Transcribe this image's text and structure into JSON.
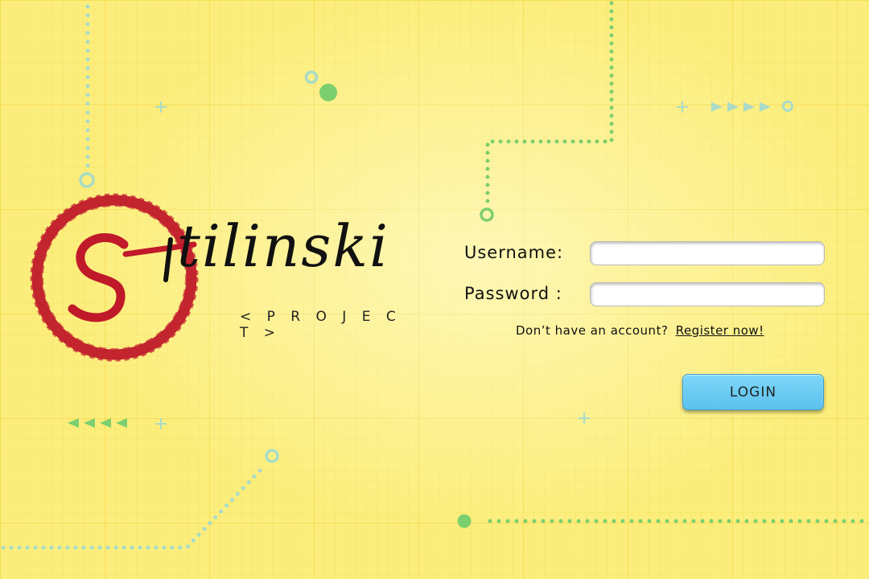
{
  "logo": {
    "word_first": "S",
    "word_rest": "tilinski",
    "subtitle": "< P R O J E C T >"
  },
  "login_form": {
    "username_label": "Username:",
    "password_label": "Password :",
    "username_value": "",
    "password_value": "",
    "register_prompt": "Don’t have an account?",
    "register_link": "Register now!",
    "login_button": "LOGIN"
  },
  "colors": {
    "background": "#fcee7c",
    "logo_red": "#c0192a",
    "button_blue": "#6fcdf5",
    "dot_green": "#7ccf6e",
    "dot_teal": "#a9dbc8"
  }
}
